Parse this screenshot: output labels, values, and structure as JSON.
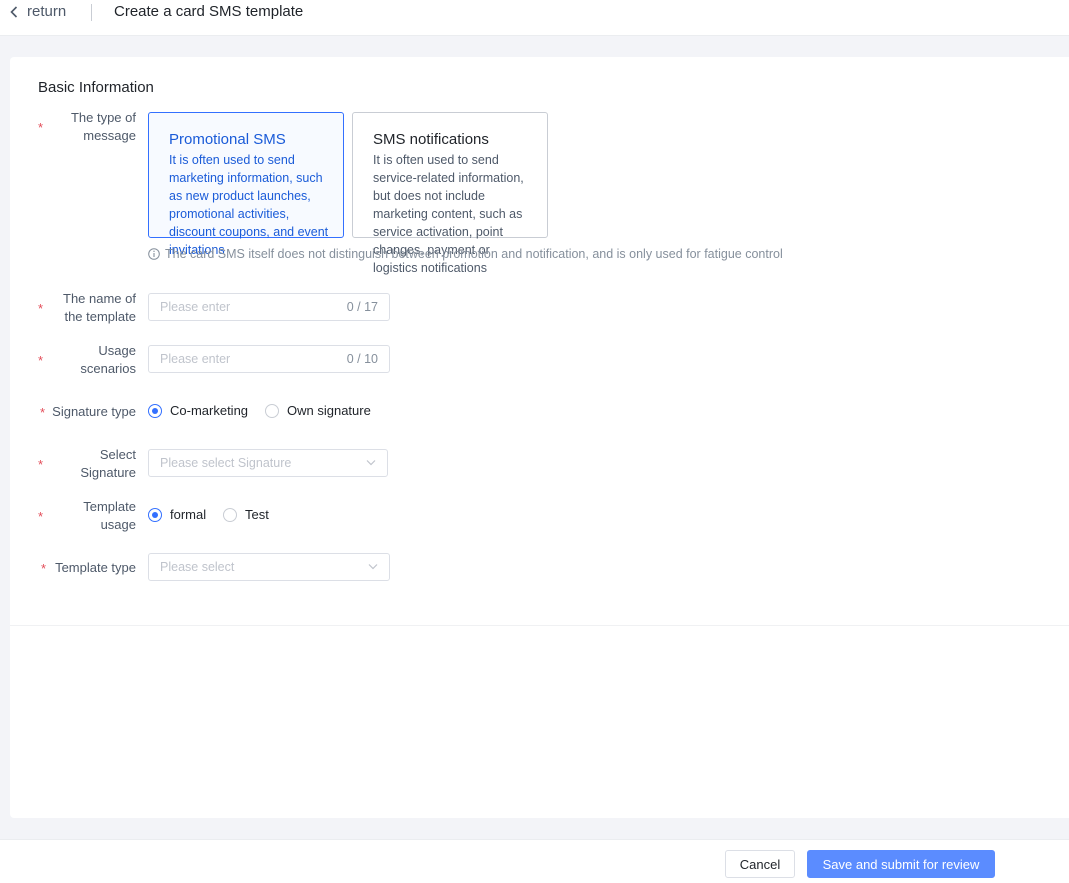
{
  "header": {
    "back_label": "return",
    "title": "Create a card SMS template"
  },
  "section": {
    "title": "Basic Information"
  },
  "form": {
    "required_mark": "*",
    "message_type": {
      "label_line1": "The type of",
      "label_line2": "message",
      "options": [
        {
          "title": "Promotional SMS",
          "description": "It is often used to send marketing information, such as new product launches, promotional activities, discount coupons, and event invitations",
          "selected": true
        },
        {
          "title": "SMS notifications",
          "description": "It is often used to send service-related information, but does not include marketing content, such as service activation, point changes, payment or logistics notifications",
          "selected": false
        }
      ],
      "hint": "The card SMS itself does not distinguish between promotion and notification, and is only used for fatigue control"
    },
    "template_name": {
      "label_line1": "The name of",
      "label_line2": "the template",
      "placeholder": "Please enter",
      "counter": "0 / 17"
    },
    "usage_scenarios": {
      "label_line1": "Usage",
      "label_line2": "scenarios",
      "placeholder": "Please enter",
      "counter": "0 / 10"
    },
    "signature_type": {
      "label": "Signature type",
      "options": [
        {
          "label": "Co-marketing",
          "checked": true
        },
        {
          "label": "Own signature",
          "checked": false
        }
      ]
    },
    "select_signature": {
      "label_line1": "Select",
      "label_line2": "Signature",
      "placeholder": "Please select Signature"
    },
    "template_usage": {
      "label_line1": "Template",
      "label_line2": "usage",
      "options": [
        {
          "label": "formal",
          "checked": true
        },
        {
          "label": "Test",
          "checked": false
        }
      ]
    },
    "template_type": {
      "label": "Template type",
      "placeholder": "Please select"
    }
  },
  "footer": {
    "cancel_label": "Cancel",
    "submit_label": "Save and submit for review"
  },
  "colors": {
    "primary": "#3370ff",
    "button_primary": "#5b8cff",
    "required": "#e34d59"
  }
}
